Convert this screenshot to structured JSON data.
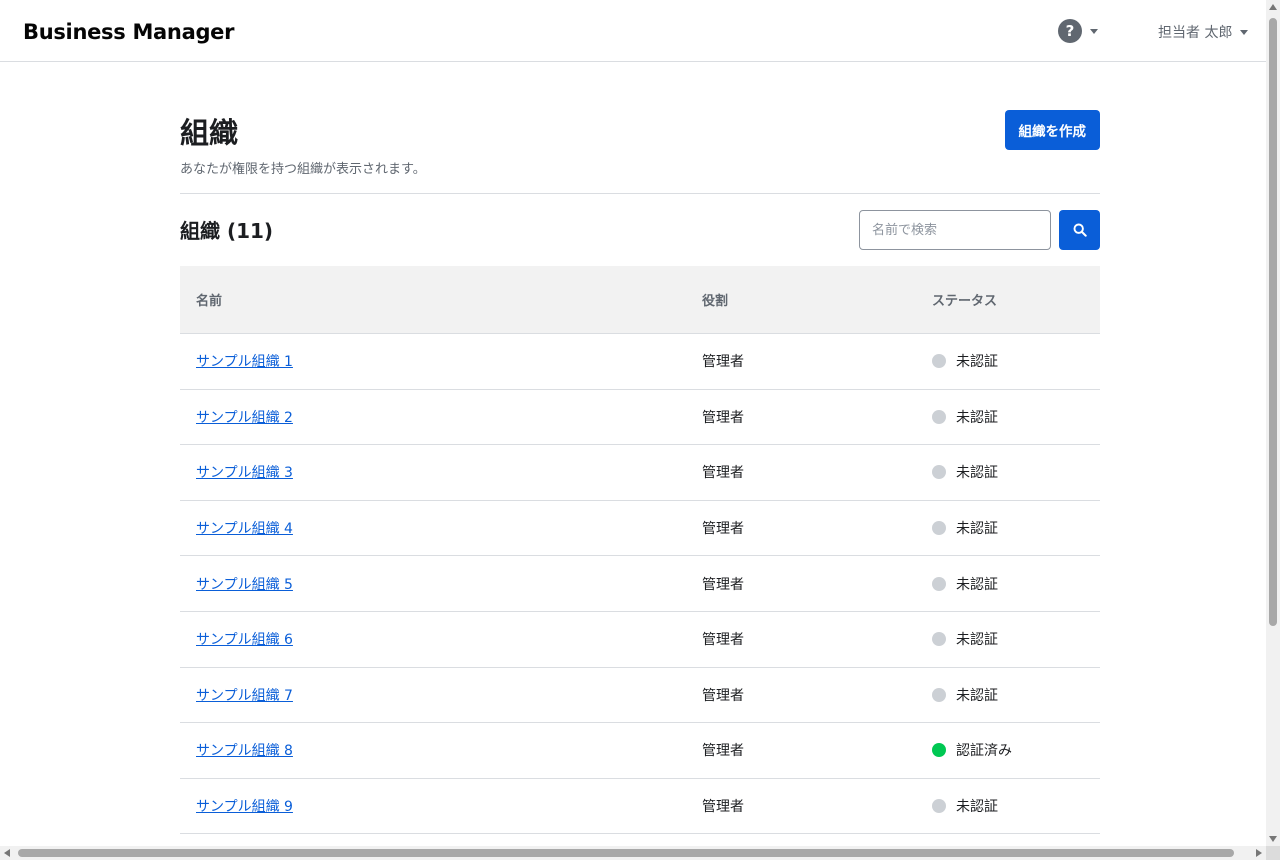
{
  "header": {
    "logo": "Business Manager",
    "help_symbol": "?",
    "user_name": "担当者 太郎"
  },
  "page": {
    "title": "組織",
    "description": "あなたが権限を持つ組織が表示されます。",
    "create_button": "組織を作成"
  },
  "section": {
    "title": "組織 (11)",
    "search_placeholder": "名前で検索"
  },
  "table": {
    "columns": [
      "名前",
      "役割",
      "ステータス"
    ],
    "rows": [
      {
        "name": "サンプル組織 1",
        "role": "管理者",
        "status": "未認証",
        "verified": false
      },
      {
        "name": "サンプル組織 2",
        "role": "管理者",
        "status": "未認証",
        "verified": false
      },
      {
        "name": "サンプル組織 3",
        "role": "管理者",
        "status": "未認証",
        "verified": false
      },
      {
        "name": "サンプル組織 4",
        "role": "管理者",
        "status": "未認証",
        "verified": false
      },
      {
        "name": "サンプル組織 5",
        "role": "管理者",
        "status": "未認証",
        "verified": false
      },
      {
        "name": "サンプル組織 6",
        "role": "管理者",
        "status": "未認証",
        "verified": false
      },
      {
        "name": "サンプル組織 7",
        "role": "管理者",
        "status": "未認証",
        "verified": false
      },
      {
        "name": "サンプル組織 8",
        "role": "管理者",
        "status": "認証済み",
        "verified": true
      },
      {
        "name": "サンプル組織 9",
        "role": "管理者",
        "status": "未認証",
        "verified": false
      }
    ]
  },
  "colors": {
    "accent": "#0a5ed8",
    "verified": "#00c853",
    "unverified": "#ccd0d5"
  }
}
